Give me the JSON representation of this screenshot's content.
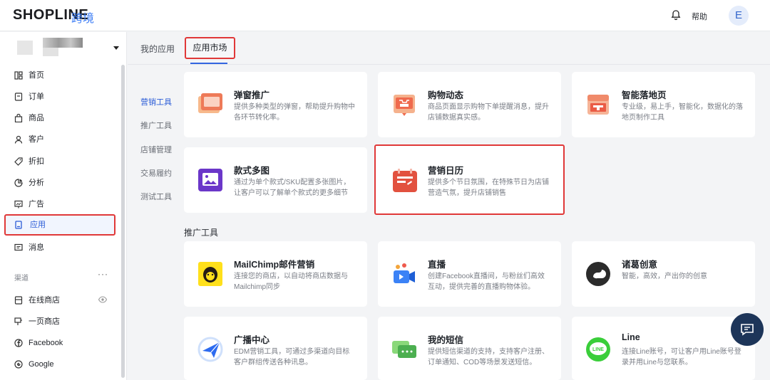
{
  "header": {
    "logo": "SHOPLINE",
    "logo_sub": "跨境",
    "help": "帮助",
    "avatar": "E"
  },
  "sidebar": {
    "items": [
      {
        "label": "首页",
        "icon": "home-icon"
      },
      {
        "label": "订单",
        "icon": "order-icon"
      },
      {
        "label": "商品",
        "icon": "bag-icon"
      },
      {
        "label": "客户",
        "icon": "user-icon"
      },
      {
        "label": "折扣",
        "icon": "tag-icon"
      },
      {
        "label": "分析",
        "icon": "chart-icon"
      },
      {
        "label": "广告",
        "icon": "ad-icon"
      },
      {
        "label": "应用",
        "icon": "app-icon"
      },
      {
        "label": "消息",
        "icon": "message-icon"
      }
    ],
    "channels_label": "渠道",
    "channels_more": "···",
    "channels": [
      {
        "label": "在线商店",
        "icon": "store-icon"
      },
      {
        "label": "一页商店",
        "icon": "page-store-icon"
      },
      {
        "label": "Facebook",
        "icon": "facebook-icon"
      },
      {
        "label": "Google",
        "icon": "google-icon"
      }
    ]
  },
  "tabs": {
    "my_apps": "我的应用",
    "market": "应用市场"
  },
  "categories": [
    "营销工具",
    "推广工具",
    "店铺管理",
    "交易履约",
    "测试工具"
  ],
  "promo_section_title": "推广工具",
  "cards": [
    {
      "title": "弹窗推广",
      "desc": "提供多种类型的弹窗，帮助提升购物中各环节转化率。",
      "icon": "popup-icon"
    },
    {
      "title": "购物动态",
      "desc": "商品页面显示购物下单提醒消息，提升店铺数据真实感。",
      "icon": "shopping-feed-icon"
    },
    {
      "title": "智能落地页",
      "desc": "专业级，易上手，智能化，数据化的落地页制作工具",
      "icon": "landing-page-icon"
    },
    {
      "title": "款式多图",
      "desc": "通过为单个款式/SKU配置多张图片，让客户可以了解单个款式的更多细节",
      "icon": "multi-image-icon"
    },
    {
      "title": "营销日历",
      "desc": "提供多个节日氛围，在特殊节日为店铺营造气氛，提升店铺销售",
      "icon": "calendar-icon"
    },
    {
      "title": "MailChimp邮件营销",
      "desc": "连接您的商店，以自动将商店数据与Mailchimp同步",
      "icon": "mailchimp-icon"
    },
    {
      "title": "直播",
      "desc": "创建Facebook直播间，与粉丝们高效互动，提供完善的直播购物体验。",
      "icon": "live-icon"
    },
    {
      "title": "诸葛创意",
      "desc": "智能，高效，产出你的创意",
      "icon": "zhuge-icon"
    },
    {
      "title": "广播中心",
      "desc": "EDM营销工具，可通过多渠道向目标客户群组传送各种讯息。",
      "icon": "broadcast-icon"
    },
    {
      "title": "我的短信",
      "desc": "提供短信渠道的支持，支持客户注册、订单通知、COD等场景发送短信。",
      "icon": "sms-icon"
    },
    {
      "title": "Line",
      "desc": "连接Line账号，可让客户用Line账号登录并用Line与您联系。",
      "icon": "line-icon"
    }
  ],
  "colors": {
    "accent": "#2a5bd7",
    "highlight": "#e03838",
    "fab": "#1d3559"
  }
}
